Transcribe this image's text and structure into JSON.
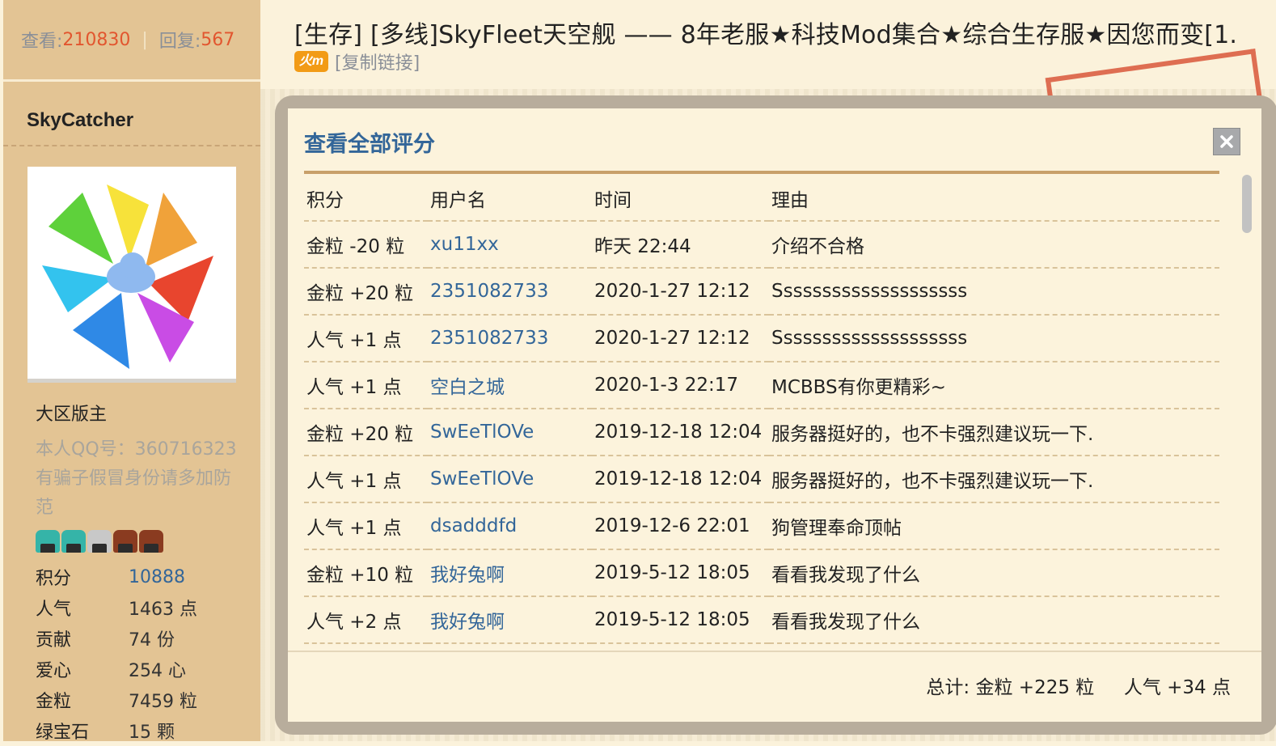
{
  "stats": {
    "views_label": "查看:",
    "views": "210830",
    "replies_label": "回复:",
    "replies": "567"
  },
  "thread": {
    "title": "[生存] [多线]SkyFleet天空舰 —— 8年老服★科技Mod集合★综合生存服★因您而变[1.",
    "copy_link": "[复制链接]",
    "badge": "火m"
  },
  "author": {
    "username": "SkyCatcher",
    "group": "大区版主",
    "note": "本人QQ号：360716323有骗子假冒身份请多加防范",
    "medal_colors": [
      "#35b4a8",
      "#35b4a8",
      "#c8c8c8",
      "#8a3b20",
      "#8a3b20"
    ],
    "profile": [
      {
        "label": "积分",
        "value": "10888",
        "link": true
      },
      {
        "label": "人气",
        "value": "1463 点",
        "link": false
      },
      {
        "label": "贡献",
        "value": "74 份",
        "link": false
      },
      {
        "label": "爱心",
        "value": "254 心",
        "link": false
      },
      {
        "label": "金粒",
        "value": "7459 粒",
        "link": false
      },
      {
        "label": "绿宝石",
        "value": "15 颗",
        "link": false
      }
    ]
  },
  "modal": {
    "title": "查看全部评分",
    "close_icon": "×",
    "columns": [
      "积分",
      "用户名",
      "时间",
      "理由"
    ],
    "rows": [
      {
        "score": "金粒 -20 粒",
        "user": "xu11xx",
        "time": "昨天 22:44",
        "reason": "介绍不合格"
      },
      {
        "score": "金粒 +20 粒",
        "user": "2351082733",
        "time": "2020-1-27 12:12",
        "reason": "Ssssssssssssssssssss"
      },
      {
        "score": "人气 +1 点",
        "user": "2351082733",
        "time": "2020-1-27 12:12",
        "reason": "Ssssssssssssssssssss"
      },
      {
        "score": "人气 +1 点",
        "user": "空白之城",
        "time": "2020-1-3 22:17",
        "reason": "MCBBS有你更精彩~"
      },
      {
        "score": "金粒 +20 粒",
        "user": "SwEeTlOVe",
        "time": "2019-12-18 12:04",
        "reason": "服务器挺好的，也不卡强烈建议玩一下."
      },
      {
        "score": "人气 +1 点",
        "user": "SwEeTlOVe",
        "time": "2019-12-18 12:04",
        "reason": "服务器挺好的，也不卡强烈建议玩一下."
      },
      {
        "score": "人气 +1 点",
        "user": "dsadddfd",
        "time": "2019-12-6 22:01",
        "reason": "狗管理奉命顶帖"
      },
      {
        "score": "金粒 +10 粒",
        "user": "我好兔啊",
        "time": "2019-5-12 18:05",
        "reason": "看看我发现了什么"
      },
      {
        "score": "人气 +2 点",
        "user": "我好兔啊",
        "time": "2019-5-12 18:05",
        "reason": "看看我发现了什么"
      }
    ],
    "total": "总计: 金粒 +225 粒     人气 +34 点"
  },
  "colors": {
    "link": "#336699",
    "accent": "#e2562f",
    "panel": "#e3c494"
  }
}
